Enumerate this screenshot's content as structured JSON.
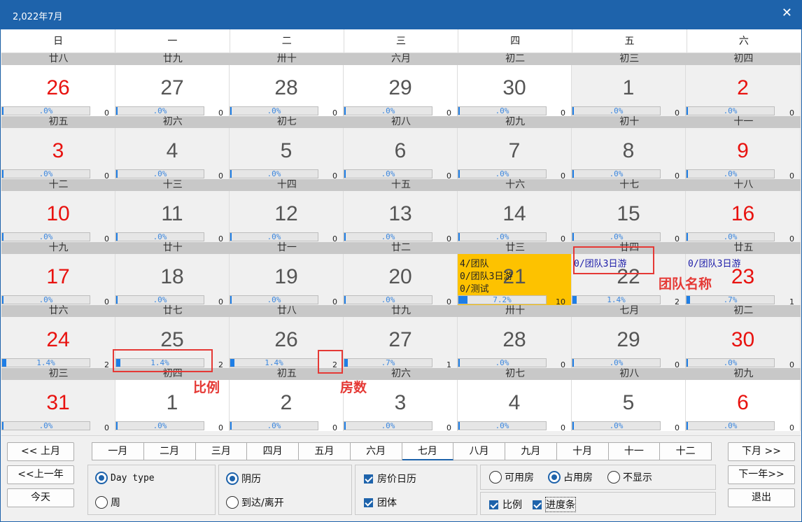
{
  "window": {
    "title": "2,022年7月",
    "close_glyph": "✕"
  },
  "weekdays": [
    "日",
    "一",
    "二",
    "三",
    "四",
    "五",
    "六"
  ],
  "weeks": [
    {
      "lunar": [
        "廿八",
        "廿九",
        "卅十",
        "六月",
        "初二",
        "初三",
        "初四"
      ],
      "days": [
        {
          "n": "26",
          "red": true,
          "bg": "white",
          "pct": ".0%",
          "cnt": "0",
          "fill": 0
        },
        {
          "n": "27",
          "red": false,
          "bg": "white",
          "pct": ".0%",
          "cnt": "0",
          "fill": 0
        },
        {
          "n": "28",
          "red": false,
          "bg": "white",
          "pct": ".0%",
          "cnt": "0",
          "fill": 0
        },
        {
          "n": "29",
          "red": false,
          "bg": "white",
          "pct": ".0%",
          "cnt": "0",
          "fill": 0
        },
        {
          "n": "30",
          "red": false,
          "bg": "white",
          "pct": ".0%",
          "cnt": "0",
          "fill": 0
        },
        {
          "n": "1",
          "red": false,
          "bg": "grey",
          "pct": ".0%",
          "cnt": "0",
          "fill": 0
        },
        {
          "n": "2",
          "red": true,
          "bg": "grey",
          "pct": ".0%",
          "cnt": "0",
          "fill": 0
        }
      ]
    },
    {
      "lunar": [
        "初五",
        "初六",
        "初七",
        "初八",
        "初九",
        "初十",
        "十一"
      ],
      "days": [
        {
          "n": "3",
          "red": true,
          "bg": "grey",
          "pct": ".0%",
          "cnt": "0",
          "fill": 0
        },
        {
          "n": "4",
          "red": false,
          "bg": "grey",
          "pct": ".0%",
          "cnt": "0",
          "fill": 0
        },
        {
          "n": "5",
          "red": false,
          "bg": "grey",
          "pct": ".0%",
          "cnt": "0",
          "fill": 0
        },
        {
          "n": "6",
          "red": false,
          "bg": "grey",
          "pct": ".0%",
          "cnt": "0",
          "fill": 0
        },
        {
          "n": "7",
          "red": false,
          "bg": "grey",
          "pct": ".0%",
          "cnt": "0",
          "fill": 0
        },
        {
          "n": "8",
          "red": false,
          "bg": "grey",
          "pct": ".0%",
          "cnt": "0",
          "fill": 0
        },
        {
          "n": "9",
          "red": true,
          "bg": "grey",
          "pct": ".0%",
          "cnt": "0",
          "fill": 0
        }
      ]
    },
    {
      "lunar": [
        "十二",
        "十三",
        "十四",
        "十五",
        "十六",
        "十七",
        "十八"
      ],
      "days": [
        {
          "n": "10",
          "red": true,
          "bg": "grey",
          "pct": ".0%",
          "cnt": "0",
          "fill": 0
        },
        {
          "n": "11",
          "red": false,
          "bg": "grey",
          "pct": ".0%",
          "cnt": "0",
          "fill": 0
        },
        {
          "n": "12",
          "red": false,
          "bg": "grey",
          "pct": ".0%",
          "cnt": "0",
          "fill": 0
        },
        {
          "n": "13",
          "red": false,
          "bg": "grey",
          "pct": ".0%",
          "cnt": "0",
          "fill": 0
        },
        {
          "n": "14",
          "red": false,
          "bg": "grey",
          "pct": ".0%",
          "cnt": "0",
          "fill": 0
        },
        {
          "n": "15",
          "red": false,
          "bg": "grey",
          "pct": ".0%",
          "cnt": "0",
          "fill": 0
        },
        {
          "n": "16",
          "red": true,
          "bg": "grey",
          "pct": ".0%",
          "cnt": "0",
          "fill": 0
        }
      ]
    },
    {
      "lunar": [
        "十九",
        "廿十",
        "廿一",
        "廿二",
        "廿三",
        "廿四",
        "廿五"
      ],
      "days": [
        {
          "n": "17",
          "red": true,
          "bg": "grey",
          "pct": ".0%",
          "cnt": "0",
          "fill": 0
        },
        {
          "n": "18",
          "red": false,
          "bg": "grey",
          "pct": ".0%",
          "cnt": "0",
          "fill": 0
        },
        {
          "n": "19",
          "red": false,
          "bg": "grey",
          "pct": ".0%",
          "cnt": "0",
          "fill": 0
        },
        {
          "n": "20",
          "red": false,
          "bg": "grey",
          "pct": ".0%",
          "cnt": "0",
          "fill": 0
        },
        {
          "n": "21",
          "red": false,
          "bg": "gold",
          "pct": "7.2%",
          "cnt": "10",
          "fill": 0.072,
          "groups": [
            "4/团队",
            "0/团队3日游",
            "0/测试"
          ],
          "groups_color": "dark"
        },
        {
          "n": "22",
          "red": false,
          "bg": "grey",
          "pct": "1.4%",
          "cnt": "2",
          "fill": 0.014,
          "groups": [
            "0/团队3日游"
          ],
          "groups_color": "blue"
        },
        {
          "n": "23",
          "red": true,
          "bg": "grey",
          "pct": ".7%",
          "cnt": "1",
          "fill": 0.007,
          "groups": [
            "0/团队3日游"
          ],
          "groups_color": "blue"
        }
      ]
    },
    {
      "lunar": [
        "廿六",
        "廿七",
        "廿八",
        "廿九",
        "卅十",
        "七月",
        "初二"
      ],
      "days": [
        {
          "n": "24",
          "red": true,
          "bg": "grey",
          "pct": "1.4%",
          "cnt": "2",
          "fill": 0.014
        },
        {
          "n": "25",
          "red": false,
          "bg": "grey",
          "pct": "1.4%",
          "cnt": "2",
          "fill": 0.014
        },
        {
          "n": "26",
          "red": false,
          "bg": "grey",
          "pct": "1.4%",
          "cnt": "2",
          "fill": 0.014
        },
        {
          "n": "27",
          "red": false,
          "bg": "grey",
          "pct": ".7%",
          "cnt": "1",
          "fill": 0.007
        },
        {
          "n": "28",
          "red": false,
          "bg": "grey",
          "pct": ".0%",
          "cnt": "0",
          "fill": 0
        },
        {
          "n": "29",
          "red": false,
          "bg": "grey",
          "pct": ".0%",
          "cnt": "0",
          "fill": 0
        },
        {
          "n": "30",
          "red": true,
          "bg": "grey",
          "pct": ".0%",
          "cnt": "0",
          "fill": 0
        }
      ]
    },
    {
      "lunar": [
        "初三",
        "初四",
        "初五",
        "初六",
        "初七",
        "初八",
        "初九"
      ],
      "days": [
        {
          "n": "31",
          "red": true,
          "bg": "grey",
          "pct": ".0%",
          "cnt": "0",
          "fill": 0
        },
        {
          "n": "1",
          "red": false,
          "bg": "white",
          "pct": ".0%",
          "cnt": "0",
          "fill": 0
        },
        {
          "n": "2",
          "red": false,
          "bg": "white",
          "pct": ".0%",
          "cnt": "0",
          "fill": 0
        },
        {
          "n": "3",
          "red": false,
          "bg": "white",
          "pct": ".0%",
          "cnt": "0",
          "fill": 0
        },
        {
          "n": "4",
          "red": false,
          "bg": "white",
          "pct": ".0%",
          "cnt": "0",
          "fill": 0
        },
        {
          "n": "5",
          "red": false,
          "bg": "white",
          "pct": ".0%",
          "cnt": "0",
          "fill": 0
        },
        {
          "n": "6",
          "red": true,
          "bg": "white",
          "pct": ".0%",
          "cnt": "0",
          "fill": 0
        }
      ]
    }
  ],
  "annotations": {
    "group_name": "团队名称",
    "ratio": "比例",
    "rooms": "房数"
  },
  "nav": {
    "prev_month": "<< 上月",
    "prev_year": "<<上一年",
    "today": "今天",
    "next_month": "下月 >>",
    "next_year": "下一年>>",
    "exit": "退出"
  },
  "months": [
    "一月",
    "二月",
    "三月",
    "四月",
    "五月",
    "六月",
    "七月",
    "八月",
    "九月",
    "十月",
    "十一",
    "十二"
  ],
  "active_month_index": 6,
  "options": {
    "day_type": "Day type",
    "week": "周",
    "day_type_selected": true,
    "lunar": "阴历",
    "arrive_leave": "到达/离开",
    "lunar_selected": true,
    "price_calendar": "房价日历",
    "price_calendar_checked": true,
    "group": "团体",
    "group_checked": true,
    "available": "可用房",
    "occupied": "占用房",
    "hide": "不显示",
    "room_mode_selected": "occupied",
    "ratio": "比例",
    "ratio_checked": true,
    "progress": "进度条",
    "progress_checked": true
  },
  "colors": {
    "title_bar": "#1e63ab",
    "red_day": "#e8120f",
    "highlight_day": "#fdc200",
    "progress_fill": "#1e7ee6",
    "annotation": "#e53935"
  }
}
